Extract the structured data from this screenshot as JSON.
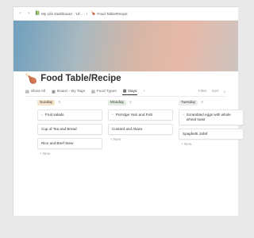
{
  "topbar": {
    "back_icon": "‹",
    "forward_icon": "›",
    "crumb1_icon": "📗",
    "crumb1_label": "My Life Dashboard - 'Ul'...",
    "separator": "/",
    "crumb2_icon": "🍗",
    "crumb2_label": "Food Table/Recipe"
  },
  "page": {
    "icon": "🍗",
    "title": "Food Table/Recipe"
  },
  "tabs": {
    "items": [
      {
        "icon": "▤",
        "label": "Show All"
      },
      {
        "icon": "▦",
        "label": "Board – By Tags"
      },
      {
        "icon": "▤",
        "label": "Food Types"
      },
      {
        "icon": "▦",
        "label": "Days"
      }
    ],
    "add": "+",
    "filter": "Filter",
    "sort": "Sort",
    "search_icon": "⌕"
  },
  "board": {
    "columns": [
      {
        "label": "Sunday",
        "count": "3",
        "color": "#f6e4cc",
        "cards": [
          {
            "icon": "▫",
            "title": "Fruit salads"
          },
          {
            "icon": "",
            "title": "Cup of Tea and Bread"
          },
          {
            "icon": "",
            "title": "Rice and Beef Stew"
          }
        ],
        "new_label": "+ New"
      },
      {
        "label": "Monday",
        "count": "2",
        "color": "#e3ece0",
        "cards": [
          {
            "icon": "▫",
            "title": "Porridge Yam and Fish"
          },
          {
            "icon": "",
            "title": "Custard and Akara"
          }
        ],
        "new_label": "+ New"
      },
      {
        "label": "Tuesday",
        "count": "2",
        "color": "#ececec",
        "cards": [
          {
            "icon": "▫",
            "title": "Scrambled eggs with whole wheat toast"
          },
          {
            "icon": "",
            "title": "Spaghetti Jollof"
          }
        ],
        "new_label": "+ New"
      }
    ]
  }
}
